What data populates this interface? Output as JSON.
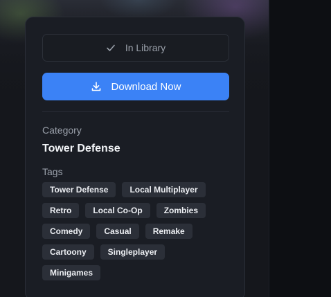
{
  "library_button": {
    "label": "In Library",
    "icon": "check-icon"
  },
  "download_button": {
    "label": "Download Now",
    "icon": "download-icon"
  },
  "category": {
    "label": "Category",
    "value": "Tower Defense"
  },
  "tags": {
    "label": "Tags",
    "rows": [
      [
        "Tower Defense",
        "Local Multiplayer"
      ],
      [
        "Retro",
        "Local Co-Op",
        "Zombies"
      ],
      [
        "Comedy",
        "Casual",
        "Remake"
      ],
      [
        "Cartoony",
        "Singleplayer"
      ],
      [
        "Minigames"
      ]
    ]
  },
  "colors": {
    "accent": "#3b82f6",
    "card_bg": "#1a1d24",
    "tag_bg": "#2b2f38"
  }
}
